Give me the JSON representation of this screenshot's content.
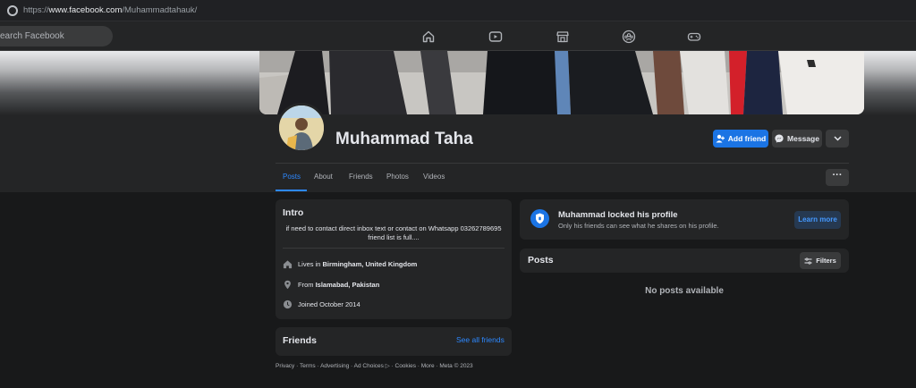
{
  "browser": {
    "url_prefix": "https://",
    "url_domain": "www.facebook.com",
    "url_path": "/Muhammadtahauk/"
  },
  "topbar": {
    "search_placeholder": "Search Facebook",
    "search_visible_text": "earch Facebook"
  },
  "profile": {
    "name": "Muhammad Taha",
    "add_friend_label": "Add friend",
    "message_label": "Message"
  },
  "tabs": [
    "Posts",
    "About",
    "Friends",
    "Photos",
    "Videos"
  ],
  "intro": {
    "title": "Intro",
    "bio_line1": "if need to contact direct inbox text or contact on Whatsapp 03262789695",
    "bio_line2": "friend list is full....",
    "lives_prefix": "Lives in ",
    "lives_place": "Birmingham, United Kingdom",
    "from_prefix": "From ",
    "from_place": "Islamabad, Pakistan",
    "joined": "Joined October 2014"
  },
  "friends": {
    "title": "Friends",
    "see_all": "See all friends"
  },
  "footer": {
    "left": "Privacy · Terms · Advertising · Ad Choices",
    "right": "· Cookies · More · Meta © 2023"
  },
  "locked": {
    "title": "Muhammad locked his profile",
    "subtitle": "Only his friends can see what he shares on his profile.",
    "learn_more": "Learn more"
  },
  "posts": {
    "title": "Posts",
    "filters_label": "Filters",
    "empty": "No posts available"
  },
  "colors": {
    "accent": "#1b74e4",
    "link": "#2d88ff",
    "background": "#18191a",
    "card": "#242526"
  }
}
